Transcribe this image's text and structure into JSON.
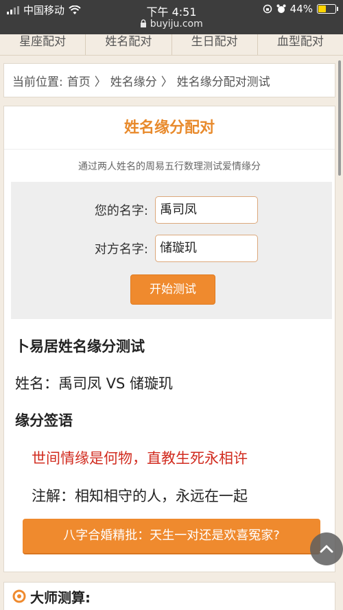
{
  "status_bar": {
    "carrier": "中国移动",
    "time": "下午 4:51",
    "url": "buyiju.com",
    "battery": "44%",
    "battery_level": 0.44
  },
  "top_nav": [
    "星座配对",
    "姓名配对",
    "生日配对",
    "血型配对"
  ],
  "breadcrumb": {
    "prefix": "当前位置:",
    "items": [
      "首页",
      "姓名缘分",
      "姓名缘分配对测试"
    ],
    "separator": "〉"
  },
  "card": {
    "title": "姓名缘分配对",
    "subtitle": "通过两人姓名的周易五行数理测试爱情缘分"
  },
  "form": {
    "your_name_label": "您的名字:",
    "your_name_value": "禹司凤",
    "other_name_label": "对方名字:",
    "other_name_value": "储璇玑",
    "submit_label": "开始测试"
  },
  "result": {
    "heading": "卜易居姓名缘分测试",
    "names": "姓名：禹司凤 VS 储璇玑",
    "section": "缘分签语",
    "verse": "世间情缘是何物，直教生死永相许",
    "note": "注解：相知相守的人，永远在一起"
  },
  "bazi_button": "八字合婚精批：天生一对还是欢喜冤家?",
  "master": {
    "label": "大师测算:"
  },
  "colors": {
    "accent": "#ef8a2e",
    "title": "#e88a2c",
    "verse": "#d12b1f"
  }
}
